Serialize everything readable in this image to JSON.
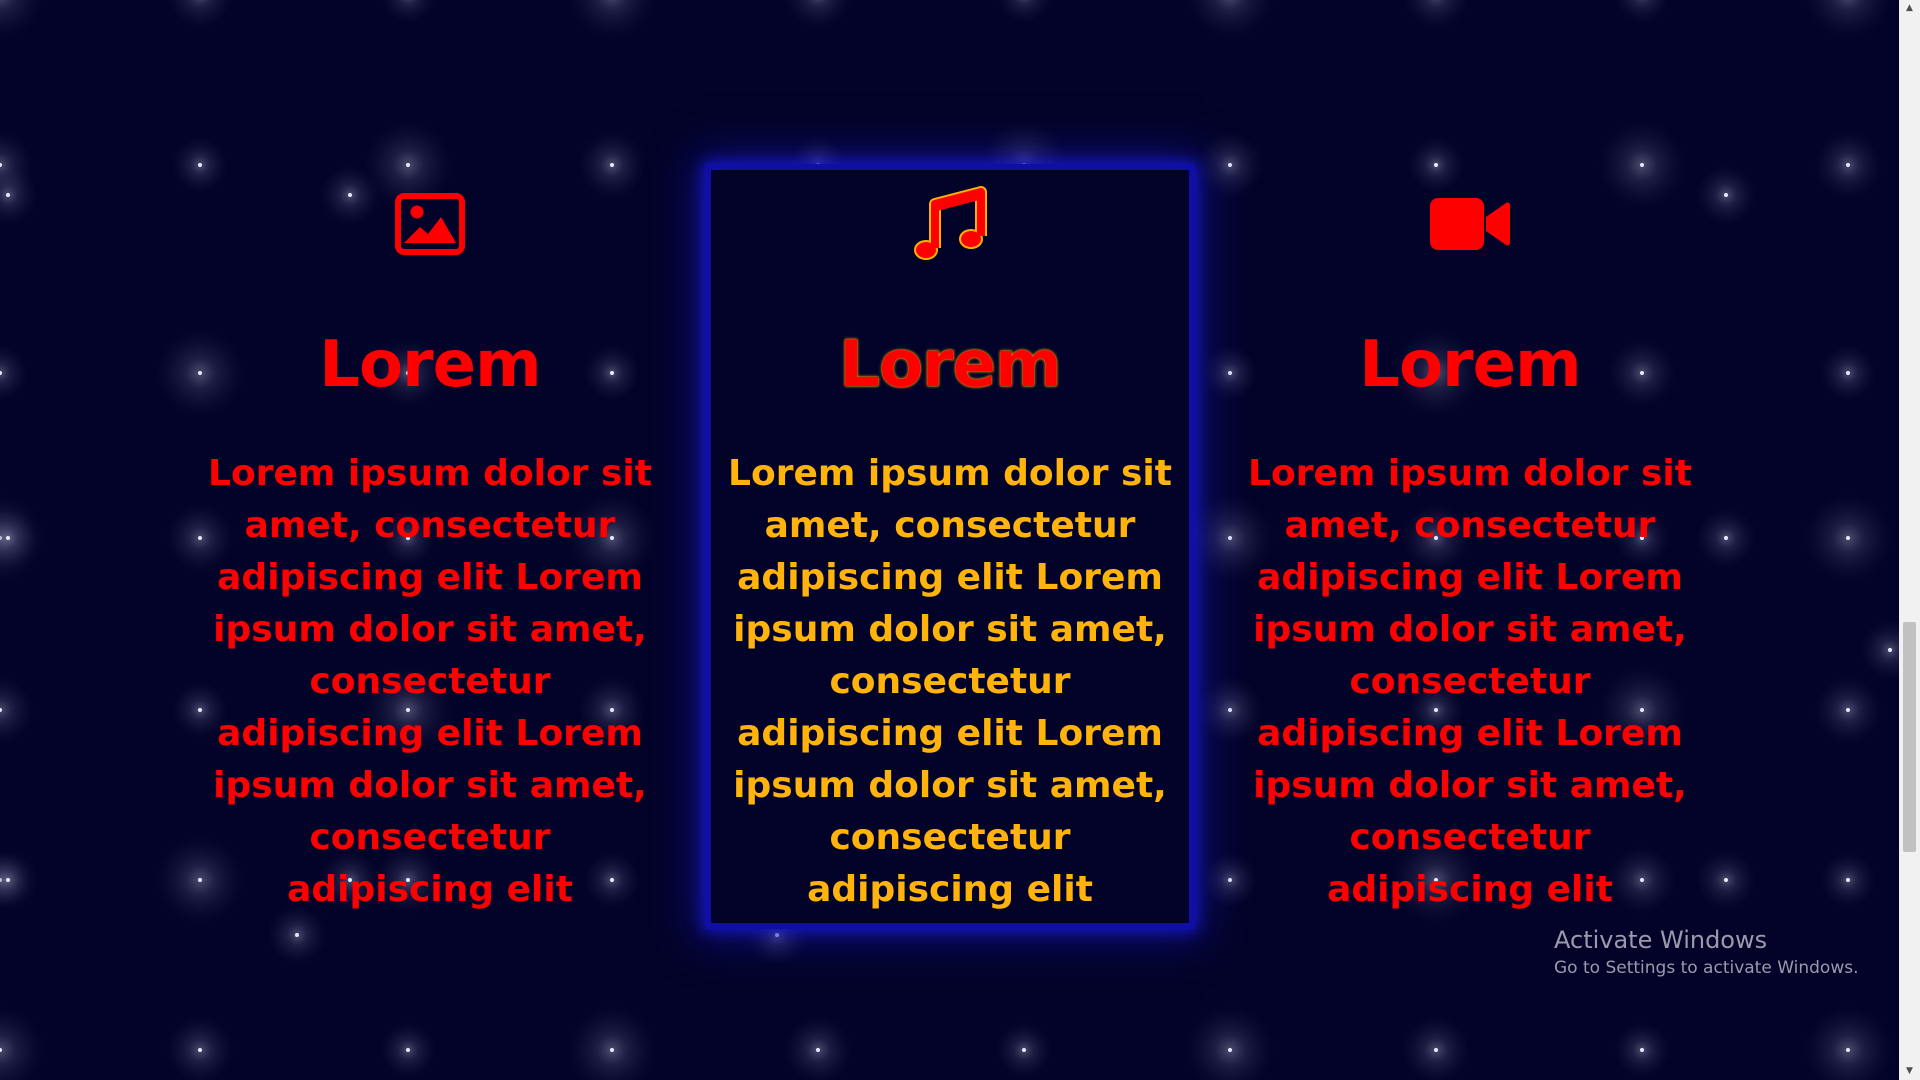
{
  "cards": [
    {
      "icon": "image-icon",
      "title": "Lorem",
      "text": "Lorem ipsum dolor sit amet, consectetur adipiscing elit Lorem ipsum dolor sit amet, consectetur adipiscing elit Lorem ipsum dolor sit amet, consectetur adipiscing elit",
      "active": false
    },
    {
      "icon": "music-note-icon",
      "title": "Lorem",
      "text": "Lorem ipsum dolor sit amet, consectetur adipiscing elit Lorem ipsum dolor sit amet, consectetur adipiscing elit Lorem ipsum dolor sit amet, consectetur adipiscing elit",
      "active": true
    },
    {
      "icon": "video-camera-icon",
      "title": "Lorem",
      "text": "Lorem ipsum dolor sit amet, consectetur adipiscing elit Lorem ipsum dolor sit amet, consectetur adipiscing elit Lorem ipsum dolor sit amet, consectetur adipiscing elit",
      "active": false
    }
  ],
  "watermark": {
    "title": "Activate Windows",
    "subtitle": "Go to Settings to activate Windows."
  },
  "colors": {
    "background": "#030329",
    "accent_red": "#ff0000",
    "active_text": "#ffb30b",
    "active_glow": "#1616c8"
  }
}
